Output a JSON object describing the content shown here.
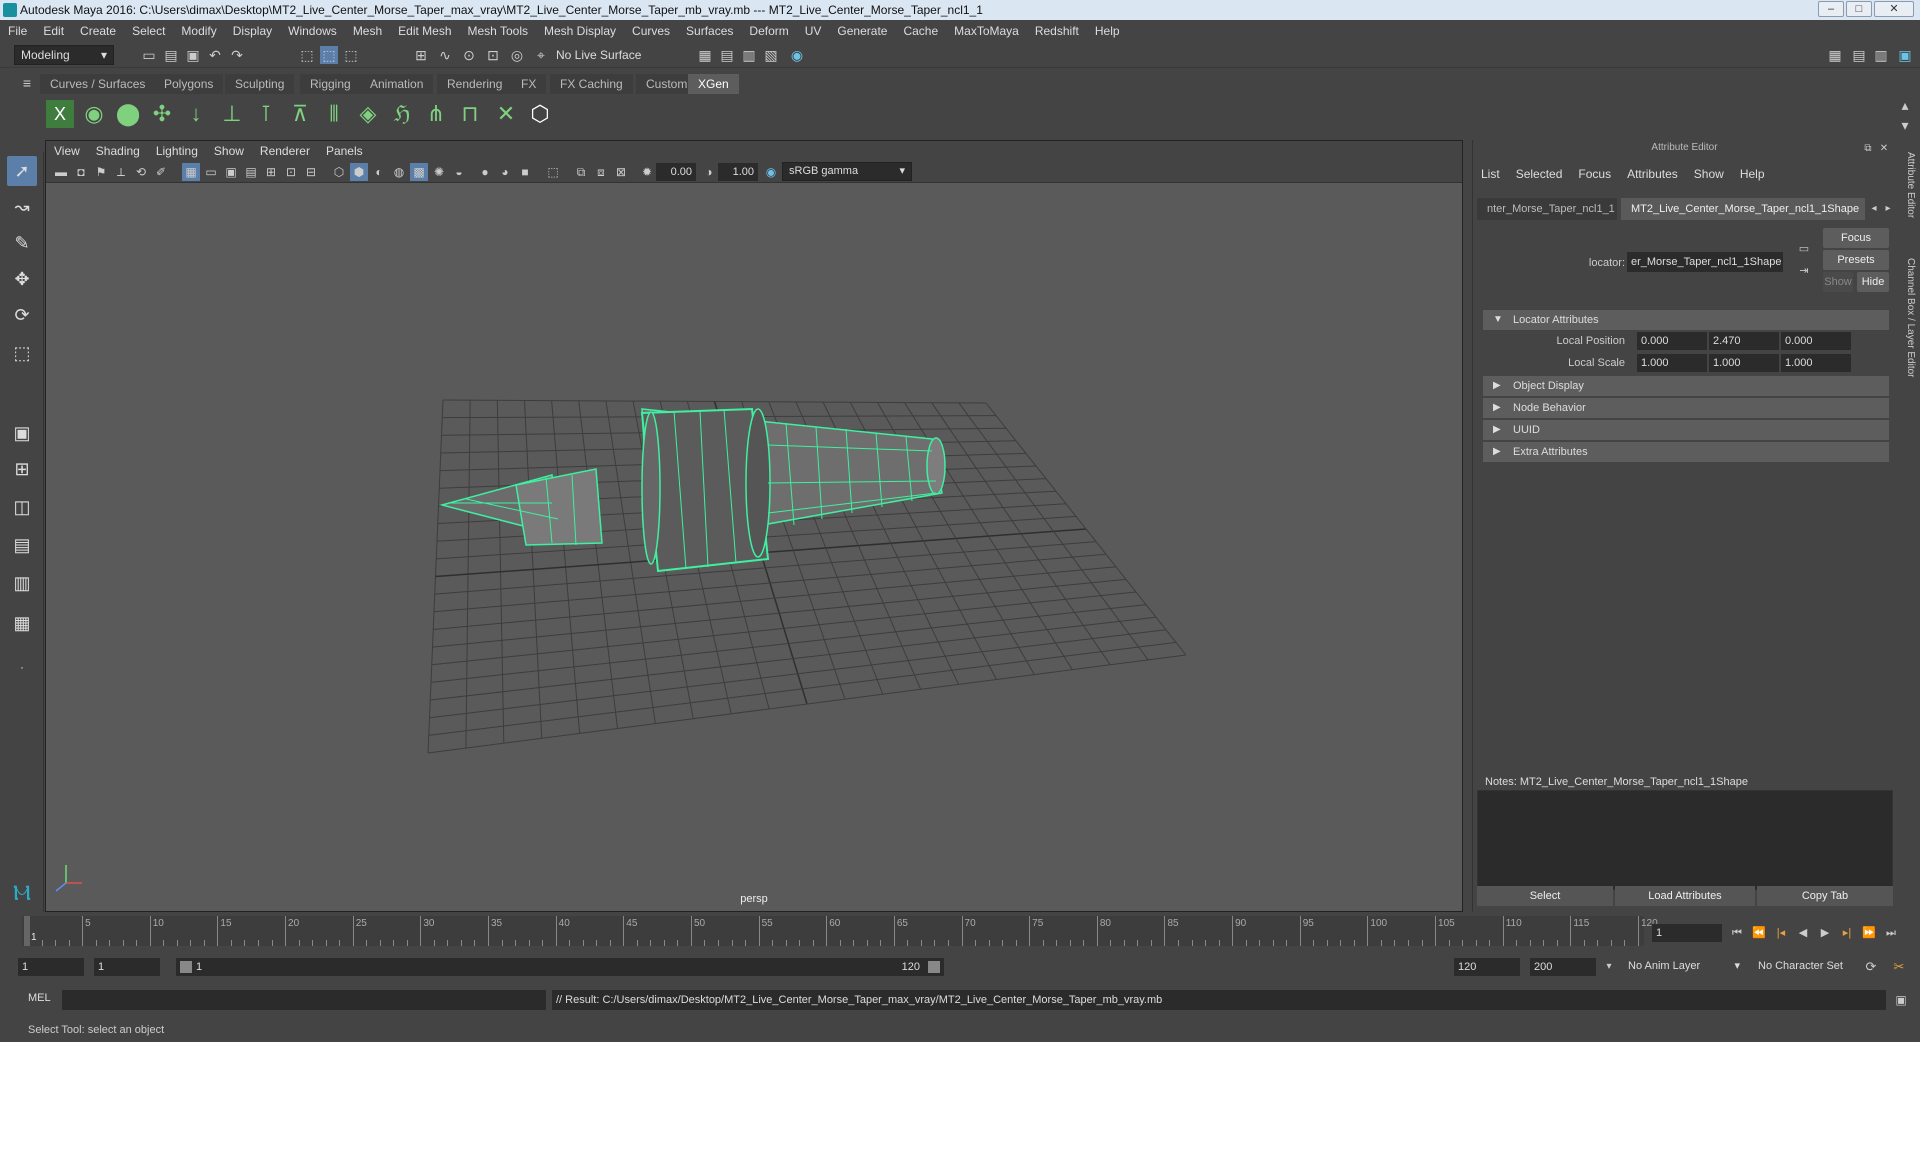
{
  "window": {
    "title": "Autodesk Maya 2016: C:\\Users\\dimax\\Desktop\\MT2_Live_Center_Morse_Taper_max_vray\\MT2_Live_Center_Morse_Taper_mb_vray.mb   ---   MT2_Live_Center_Morse_Taper_ncl1_1"
  },
  "menu": [
    "File",
    "Edit",
    "Create",
    "Select",
    "Modify",
    "Display",
    "Windows",
    "Mesh",
    "Edit Mesh",
    "Mesh Tools",
    "Mesh Display",
    "Curves",
    "Surfaces",
    "Deform",
    "UV",
    "Generate",
    "Cache",
    "MaxToMaya",
    "Redshift",
    "Help"
  ],
  "status": {
    "mode": "Modeling",
    "live_surface": "No Live Surface"
  },
  "shelf_tabs": [
    "Curves / Surfaces",
    "Polygons",
    "Sculpting",
    "Rigging",
    "Animation",
    "Rendering",
    "FX",
    "FX Caching",
    "Custom",
    "XGen"
  ],
  "viewport": {
    "menu": [
      "View",
      "Shading",
      "Lighting",
      "Show",
      "Renderer",
      "Panels"
    ],
    "exposure": "0.00",
    "gamma": "1.00",
    "colorspace": "sRGB gamma",
    "camera": "persp"
  },
  "attr": {
    "title": "Attribute Editor",
    "menu": [
      "List",
      "Selected",
      "Focus",
      "Attributes",
      "Show",
      "Help"
    ],
    "tab1": "nter_Morse_Taper_ncl1_1",
    "tab2": "MT2_Live_Center_Morse_Taper_ncl1_1Shape",
    "type_label": "locator:",
    "node_name": "er_Morse_Taper_ncl1_1Shape",
    "focus": "Focus",
    "presets": "Presets",
    "show": "Show",
    "hide": "Hide",
    "sections": [
      "Locator Attributes",
      "Object Display",
      "Node Behavior",
      "UUID",
      "Extra Attributes"
    ],
    "local_position_label": "Local Position",
    "local_position": [
      "0.000",
      "2.470",
      "0.000"
    ],
    "local_scale_label": "Local Scale",
    "local_scale": [
      "1.000",
      "1.000",
      "1.000"
    ],
    "notes_label": "Notes:  MT2_Live_Center_Morse_Taper_ncl1_1Shape",
    "select": "Select",
    "load": "Load Attributes",
    "copy": "Copy Tab"
  },
  "side_tabs": [
    "Attribute Editor",
    "Channel Box / Layer Editor"
  ],
  "timeline": {
    "ticks": [
      "1",
      "5",
      "10",
      "15",
      "20",
      "25",
      "30",
      "35",
      "40",
      "45",
      "50",
      "55",
      "60",
      "65",
      "70",
      "75",
      "80",
      "85",
      "90",
      "95",
      "100",
      "105",
      "110",
      "115",
      "120"
    ],
    "current": "1"
  },
  "range": {
    "start": "1",
    "inner_start": "1",
    "slider_start": "1",
    "slider_end": "120",
    "end": "120",
    "max": "200",
    "anim_layer": "No Anim Layer",
    "char_set": "No Character Set"
  },
  "cmd": {
    "lang": "MEL",
    "result": "// Result: C:/Users/dimax/Desktop/MT2_Live_Center_Morse_Taper_max_vray/MT2_Live_Center_Morse_Taper_mb_vray.mb"
  },
  "help": "Select Tool: select an object"
}
